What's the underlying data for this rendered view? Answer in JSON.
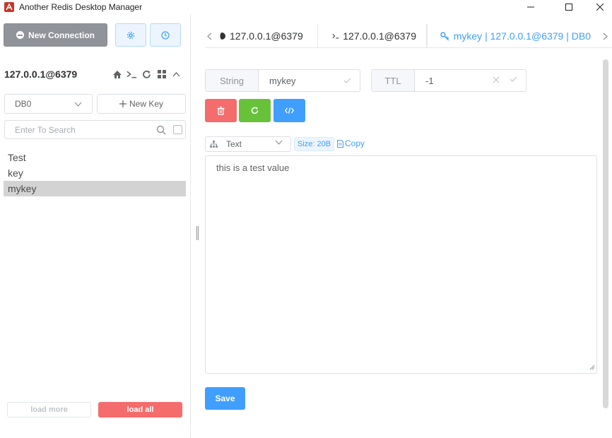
{
  "window": {
    "title": "Another Redis Desktop Manager",
    "controls": {
      "minimize": "—",
      "maximize": "☐",
      "close": "✕"
    }
  },
  "sidebar": {
    "new_connection_label": "New Connection",
    "connection_name": "127.0.0.1@6379",
    "db_select": {
      "value": "DB0"
    },
    "new_key_label": "New Key",
    "search": {
      "placeholder": "Enter To Search"
    },
    "keys": [
      {
        "name": "Test",
        "active": false
      },
      {
        "name": "key",
        "active": false
      },
      {
        "name": "mykey",
        "active": true
      }
    ],
    "load_more_label": "load more",
    "load_all_label": "load all"
  },
  "tabs": [
    {
      "label": "127.0.0.1@6379",
      "icon": "status-icon"
    },
    {
      "label": "127.0.0.1@6379",
      "icon": "terminal-icon"
    },
    {
      "label": "mykey | 127.0.0.1@6379 | DB0",
      "icon": "key-icon",
      "active": true
    }
  ],
  "key_detail": {
    "type_label": "String",
    "key_name": "mykey",
    "ttl_label": "TTL",
    "ttl_value": "-1",
    "format": "Text",
    "size_label": "Size: 20B",
    "copy_label": "Copy",
    "value": "this is a test value",
    "save_label": "Save"
  },
  "colors": {
    "primary": "#409eff",
    "danger": "#f56c6c",
    "success": "#67c23a",
    "info": "#909399"
  }
}
